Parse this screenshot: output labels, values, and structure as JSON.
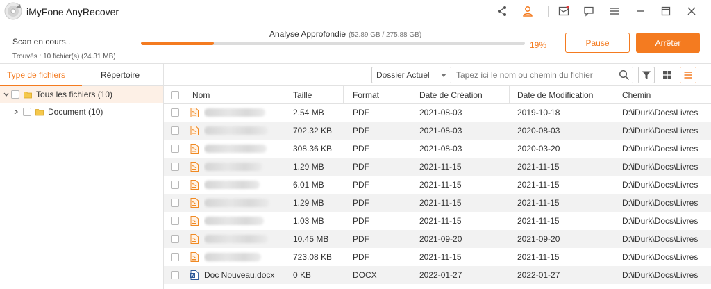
{
  "app": {
    "title": "iMyFone AnyRecover",
    "accent": "#f47b20"
  },
  "scan": {
    "status": "Scan en cours..",
    "found": "Trouvés : 10 fichier(s) (24.31 MB)",
    "mode": "Analyse Approfondie",
    "sizes": "(52.89 GB / 275.88 GB)",
    "percent_label": "19%",
    "progress": 0.19,
    "pause_label": "Pause",
    "stop_label": "Arrêter"
  },
  "sidebar": {
    "tabs": [
      {
        "label": "Type de fichiers",
        "active": true
      },
      {
        "label": "Répertoire",
        "active": false
      }
    ],
    "tree": [
      {
        "label": "Tous les fichiers (10)"
      },
      {
        "label": "Document (10)"
      }
    ]
  },
  "toolbar": {
    "location_select": "Dossier Actuel",
    "search_placeholder": "Tapez ici le nom ou chemin du fichier"
  },
  "table": {
    "columns": [
      "Nom",
      "Taille",
      "Format",
      "Date de Création",
      "Date de Modification",
      "Chemin"
    ],
    "rows": [
      {
        "name": "",
        "size": "2.54 MB",
        "format": "PDF",
        "created": "2021-08-03",
        "modified": "2019-10-18",
        "path": "D:\\iDurk\\Docs\\Livres",
        "icon": "pdf"
      },
      {
        "name": "",
        "size": "702.32 KB",
        "format": "PDF",
        "created": "2021-08-03",
        "modified": "2020-08-03",
        "path": "D:\\iDurk\\Docs\\Livres",
        "icon": "pdf"
      },
      {
        "name": "",
        "size": "308.36 KB",
        "format": "PDF",
        "created": "2021-08-03",
        "modified": "2020-03-20",
        "path": "D:\\iDurk\\Docs\\Livres",
        "icon": "pdf"
      },
      {
        "name": "",
        "size": "1.29 MB",
        "format": "PDF",
        "created": "2021-11-15",
        "modified": "2021-11-15",
        "path": "D:\\iDurk\\Docs\\Livres",
        "icon": "pdf"
      },
      {
        "name": "",
        "size": "6.01 MB",
        "format": "PDF",
        "created": "2021-11-15",
        "modified": "2021-11-15",
        "path": "D:\\iDurk\\Docs\\Livres",
        "icon": "pdf"
      },
      {
        "name": "",
        "size": "1.29 MB",
        "format": "PDF",
        "created": "2021-11-15",
        "modified": "2021-11-15",
        "path": "D:\\iDurk\\Docs\\Livres",
        "icon": "pdf"
      },
      {
        "name": "",
        "size": "1.03 MB",
        "format": "PDF",
        "created": "2021-11-15",
        "modified": "2021-11-15",
        "path": "D:\\iDurk\\Docs\\Livres",
        "icon": "pdf"
      },
      {
        "name": "",
        "size": "10.45 MB",
        "format": "PDF",
        "created": "2021-09-20",
        "modified": "2021-09-20",
        "path": "D:\\iDurk\\Docs\\Livres",
        "icon": "pdf"
      },
      {
        "name": "",
        "size": "723.08 KB",
        "format": "PDF",
        "created": "2021-11-15",
        "modified": "2021-11-15",
        "path": "D:\\iDurk\\Docs\\Livres",
        "icon": "pdf"
      },
      {
        "name": "Doc Nouveau.docx",
        "size": "0 KB",
        "format": "DOCX",
        "created": "2022-01-27",
        "modified": "2022-01-27",
        "path": "D:\\iDurk\\Docs\\Livres",
        "icon": "word"
      }
    ]
  }
}
